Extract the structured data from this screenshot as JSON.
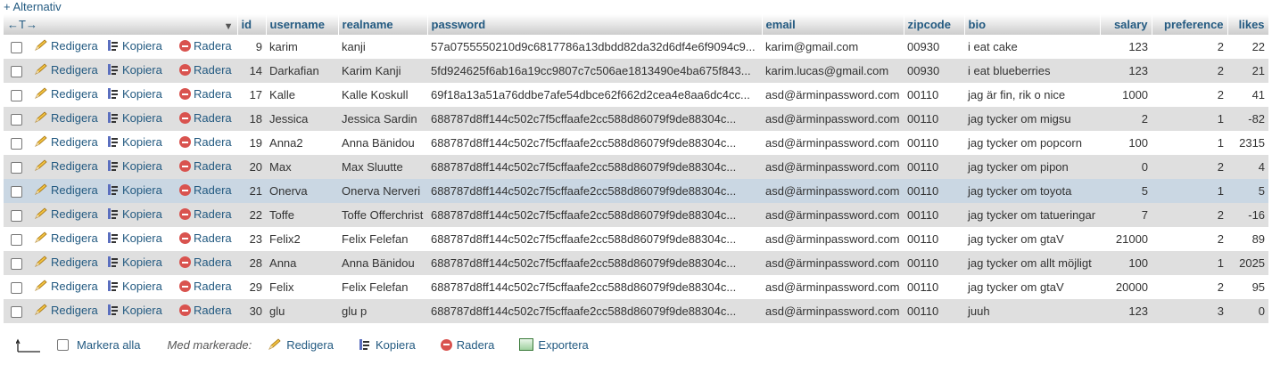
{
  "top": {
    "alternatives_link": "+ Alternativ"
  },
  "header": {
    "arrows": "←T→",
    "columns": [
      "id",
      "username",
      "realname",
      "password",
      "email",
      "zipcode",
      "bio",
      "salary",
      "preference",
      "likes"
    ]
  },
  "actions": {
    "edit": "Redigera",
    "copy": "Kopiera",
    "delete": "Radera"
  },
  "rows": [
    [
      "9",
      "karim",
      "kanji",
      "57a0755550210d9c6817786a13dbdd82da32d6df4e6f9094c9...",
      "karim@gmail.com",
      "00930",
      "i eat cake",
      "123",
      "2",
      "22"
    ],
    [
      "14",
      "Darkafian",
      "Karim Kanji",
      "5fd924625f6ab16a19cc9807c7c506ae1813490e4ba675f843...",
      "karim.lucas@gmail.com",
      "00930",
      "i eat blueberries",
      "123",
      "2",
      "21"
    ],
    [
      "17",
      "Kalle",
      "Kalle Koskull",
      "69f18a13a51a76ddbe7afe54dbce62f662d2cea4e8aa6dc4cc...",
      "asd@ärminpassword.com",
      "00110",
      "jag är fin, rik o nice",
      "1000",
      "2",
      "41"
    ],
    [
      "18",
      "Jessica",
      "Jessica Sardin",
      "688787d8ff144c502c7f5cffaafe2cc588d86079f9de88304c...",
      "asd@ärminpassword.com",
      "00110",
      "jag tycker om migsu",
      "2",
      "1",
      "-82"
    ],
    [
      "19",
      "Anna2",
      "Anna Bänidou",
      "688787d8ff144c502c7f5cffaafe2cc588d86079f9de88304c...",
      "asd@ärminpassword.com",
      "00110",
      "jag tycker om popcorn",
      "100",
      "1",
      "2315"
    ],
    [
      "20",
      "Max",
      "Max Sluutte",
      "688787d8ff144c502c7f5cffaafe2cc588d86079f9de88304c...",
      "asd@ärminpassword.com",
      "00110",
      "jag tycker om pipon",
      "0",
      "2",
      "4"
    ],
    [
      "21",
      "Onerva",
      "Onerva Nerveri",
      "688787d8ff144c502c7f5cffaafe2cc588d86079f9de88304c...",
      "asd@ärminpassword.com",
      "00110",
      "jag tycker om toyota",
      "5",
      "1",
      "5"
    ],
    [
      "22",
      "Toffe",
      "Toffe Offerchrist",
      "688787d8ff144c502c7f5cffaafe2cc588d86079f9de88304c...",
      "asd@ärminpassword.com",
      "00110",
      "jag tycker om tatueringar",
      "7",
      "2",
      "-16"
    ],
    [
      "23",
      "Felix2",
      "Felix Felefan",
      "688787d8ff144c502c7f5cffaafe2cc588d86079f9de88304c...",
      "asd@ärminpassword.com",
      "00110",
      "jag tycker om gtaV",
      "21000",
      "2",
      "89"
    ],
    [
      "28",
      "Anna",
      "Anna Bänidou",
      "688787d8ff144c502c7f5cffaafe2cc588d86079f9de88304c...",
      "asd@ärminpassword.com",
      "00110",
      "jag tycker om allt möjligt",
      "100",
      "1",
      "2025"
    ],
    [
      "29",
      "Felix",
      "Felix Felefan",
      "688787d8ff144c502c7f5cffaafe2cc588d86079f9de88304c...",
      "asd@ärminpassword.com",
      "00110",
      "jag tycker om gtaV",
      "20000",
      "2",
      "95"
    ],
    [
      "30",
      "glu",
      "glu p",
      "688787d8ff144c502c7f5cffaafe2cc588d86079f9de88304c...",
      "asd@ärminpassword.com",
      "00110",
      "juuh",
      "123",
      "3",
      "0"
    ]
  ],
  "highlighted_row_id": "21",
  "footer": {
    "check_all": "Markera alla",
    "with_selected": "Med markerade:",
    "edit": "Redigera",
    "copy": "Kopiera",
    "delete": "Radera",
    "export": "Exportera"
  },
  "colors": {
    "link": "#235a81",
    "row_even": "#dfdfdf",
    "row_highlight": "#cad7e3",
    "delete": "#d9534f"
  }
}
